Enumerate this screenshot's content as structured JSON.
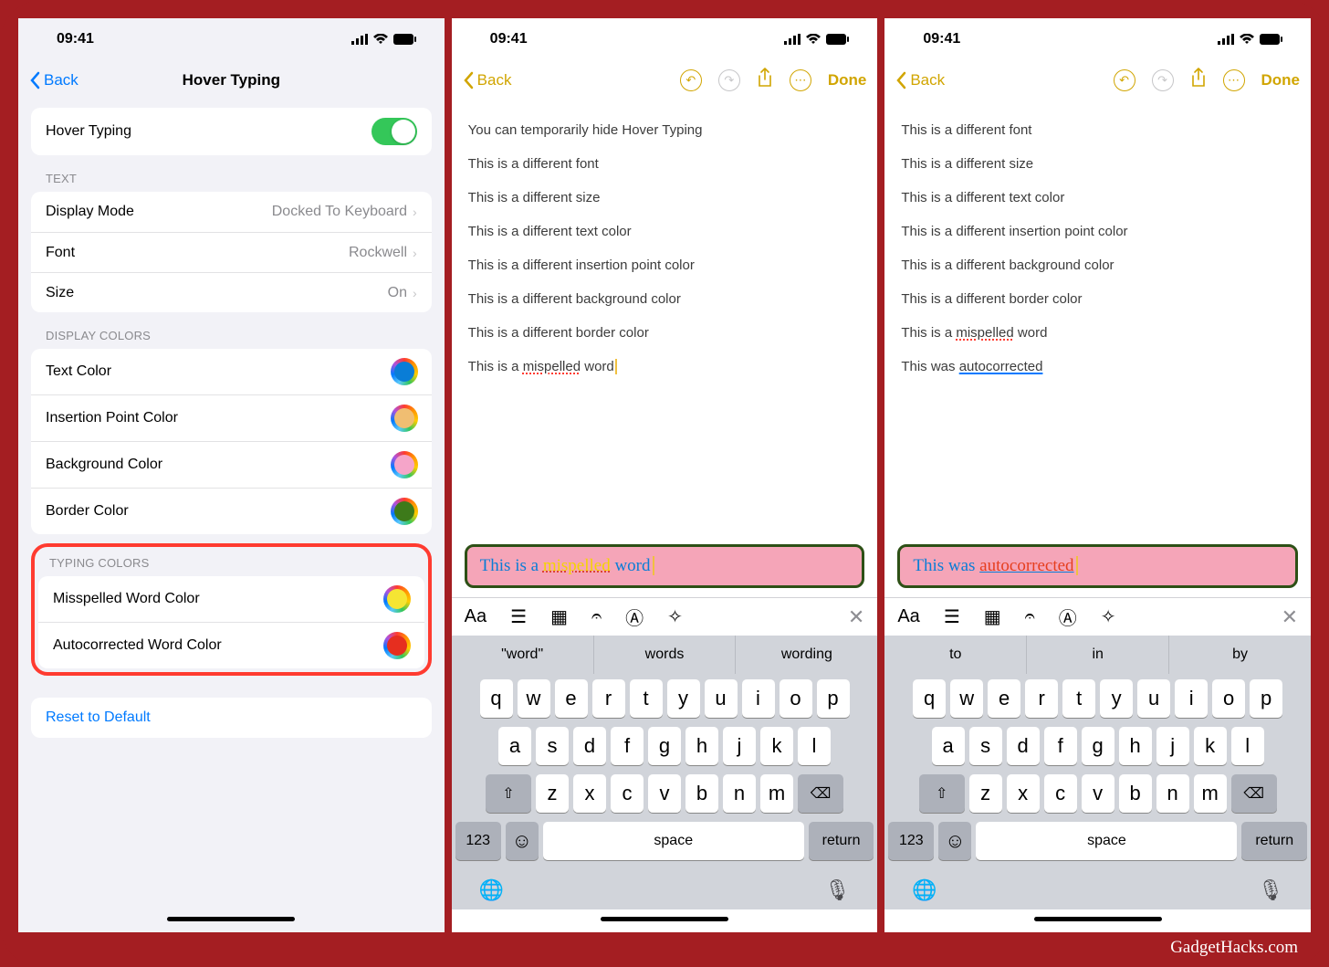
{
  "status": {
    "time": "09:41"
  },
  "settings": {
    "back": "Back",
    "title": "Hover Typing",
    "toggle_label": "Hover Typing",
    "sections": {
      "text": {
        "header": "TEXT",
        "display_mode": {
          "label": "Display Mode",
          "value": "Docked To Keyboard"
        },
        "font": {
          "label": "Font",
          "value": "Rockwell"
        },
        "size": {
          "label": "Size",
          "value": "On"
        }
      },
      "display_colors": {
        "header": "DISPLAY COLORS",
        "items": [
          {
            "label": "Text Color",
            "color": "#0a7dd6"
          },
          {
            "label": "Insertion Point Color",
            "color": "#f0be72"
          },
          {
            "label": "Background Color",
            "color": "#f5a5c9"
          },
          {
            "label": "Border Color",
            "color": "#3d7a1a"
          }
        ]
      },
      "typing_colors": {
        "header": "TYPING COLORS",
        "items": [
          {
            "label": "Misspelled Word Color",
            "color": "#f5e533"
          },
          {
            "label": "Autocorrected Word Color",
            "color": "#e62e1f"
          }
        ]
      }
    },
    "reset": "Reset to Default"
  },
  "notes": {
    "back": "Back",
    "done": "Done",
    "lines": [
      "You can temporarily hide Hover Typing",
      "This is a different font",
      "This is a different size",
      "This is a different text color",
      "This is a different insertion point color",
      "This is a different background color",
      "This is a different border color"
    ],
    "mispell_line_prefix": "This is a ",
    "mispell_word": "mispelled",
    "mispell_suffix": " word",
    "hover1": {
      "prefix": "This is a ",
      "word": "mispelled",
      "suffix": " word"
    },
    "suggestions1": [
      "\"word\"",
      "words",
      "wording"
    ],
    "lines2": [
      "This is a different font",
      "This is a different size",
      "This is a different text color",
      "This is a different insertion point color",
      "This is a different background color",
      "This is a different border color"
    ],
    "mispell2_prefix": "This is a ",
    "mispell2_word": "mispelled",
    "mispell2_suffix": " word",
    "autocorr_prefix": "This was ",
    "autocorr_word": "autocorrected",
    "hover2": {
      "prefix": "This was ",
      "word": "autocorrected"
    },
    "suggestions2": [
      "to",
      "in",
      "by"
    ]
  },
  "keyboard": {
    "row1": [
      "q",
      "w",
      "e",
      "r",
      "t",
      "y",
      "u",
      "i",
      "o",
      "p"
    ],
    "row2": [
      "a",
      "s",
      "d",
      "f",
      "g",
      "h",
      "j",
      "k",
      "l"
    ],
    "row3": [
      "z",
      "x",
      "c",
      "v",
      "b",
      "n",
      "m"
    ],
    "numbers": "123",
    "space": "space",
    "return": "return"
  },
  "watermark": "GadgetHacks.com"
}
